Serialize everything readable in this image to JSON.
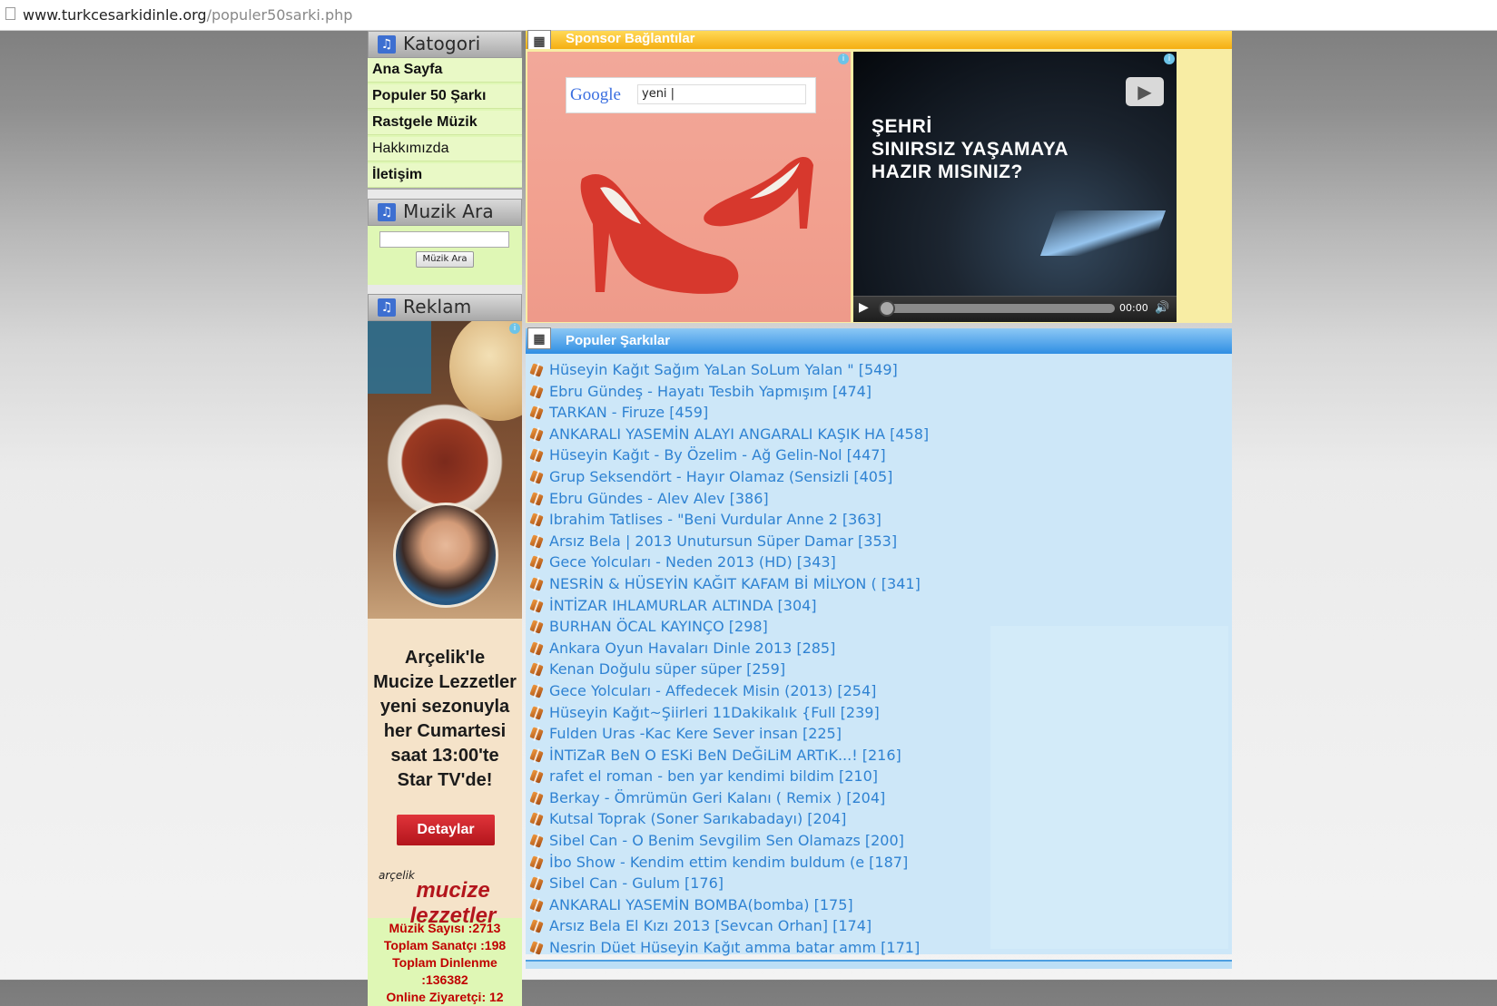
{
  "browser": {
    "url_host": "www.turkcesarkidinle.org",
    "url_path": "/populer50sarki.php"
  },
  "sidebar": {
    "category_title": "Katogori",
    "menu": [
      {
        "label": "Ana Sayfa",
        "bold": true
      },
      {
        "label": "Populer 50 Şarkı",
        "bold": true
      },
      {
        "label": "Rastgele Müzik",
        "bold": true
      },
      {
        "label": "Hakkımızda",
        "bold": false
      },
      {
        "label": "İletişim",
        "bold": true
      }
    ],
    "search_title": "Muzik Ara",
    "search_placeholder": "",
    "search_button": "Müzik Ara",
    "ad_title": "Reklam",
    "ad": {
      "slogan": "Arçelik'le\nMucize Lezzetler\nyeni sezonuyla\nher Cumartesi\nsaat 13:00'te\nStar TV'de!",
      "button": "Detaylar",
      "brand_small": "arçelik",
      "brand_big": "mucize lezzetler"
    },
    "stats": {
      "music_count": "Müzik Sayısı :2713",
      "artist_count": "Toplam Sanatçı :198",
      "listen_label": "Toplam Dinlenme",
      "listen_count": ":136382",
      "online": "Online Ziyaretçi: 12"
    }
  },
  "sponsor": {
    "title": "Sponsor Bağlantılar",
    "google_logo": "Google",
    "google_query": "yeni |",
    "video_text": "ŞEHRİ\nSINIRSIZ YAŞAMAYA\nHAZIR MISINIZ?",
    "video_time": "00:00"
  },
  "popular": {
    "title": "Populer Şarkılar",
    "songs": [
      "Hüseyin Kağıt Sağım YaLan SoLum Yalan \" [549]",
      "Ebru Gündeş - Hayatı Tesbih Yapmışım [474]",
      "TARKAN - Firuze [459]",
      "ANKARALI YASEMİN ALAYI ANGARALI KAŞIK HA [458]",
      "Hüseyin Kağıt - By Özelim - Ağ Gelin-Nol [447]",
      "Grup Seksendört - Hayır Olamaz (Sensizli [405]",
      "Ebru Gündes - Alev Alev [386]",
      "Ibrahim Tatlises - \"Beni Vurdular Anne 2 [363]",
      "Arsız Bela | 2013 Unutursun Süper Damar [353]",
      "Gece Yolcuları - Neden 2013 (HD) [343]",
      "NESRİN & HÜSEYİN KAĞIT KAFAM Bİ MİLYON ( [341]",
      "İNTİZAR IHLAMURLAR ALTINDA [304]",
      "BURHAN ÖCAL KAYINÇO [298]",
      "Ankara Oyun Havaları Dinle 2013 [285]",
      "Kenan Doğulu süper süper [259]",
      "Gece Yolcuları - Affedecek Misin (2013) [254]",
      "Hüseyin Kağıt~Şiirleri 11Dakikalık {Full [239]",
      "Fulden Uras -Kac Kere Sever insan [225]",
      "İNTiZaR BeN O ESKi BeN DeĞiLiM ARTıK...! [216]",
      "rafet el roman - ben yar kendimi bildim [210]",
      "Berkay - Ömrümün Geri Kalanı ( Remix ) [204]",
      "Kutsal Toprak (Soner Sarıkabadayı) [204]",
      "Sibel Can - O Benim Sevgilim Sen Olamazs [200]",
      "İbo Show - Kendim ettim kendim buldum (e [187]",
      "Sibel Can - Gulum [176]",
      "ANKARALI YASEMİN BOMBA(bomba) [175]",
      "Arsız Bela El Kızı 2013 [Sevcan Orhan] [174]",
      "Nesrin Düet Hüseyin Kağıt amma batar amm [171]"
    ]
  }
}
